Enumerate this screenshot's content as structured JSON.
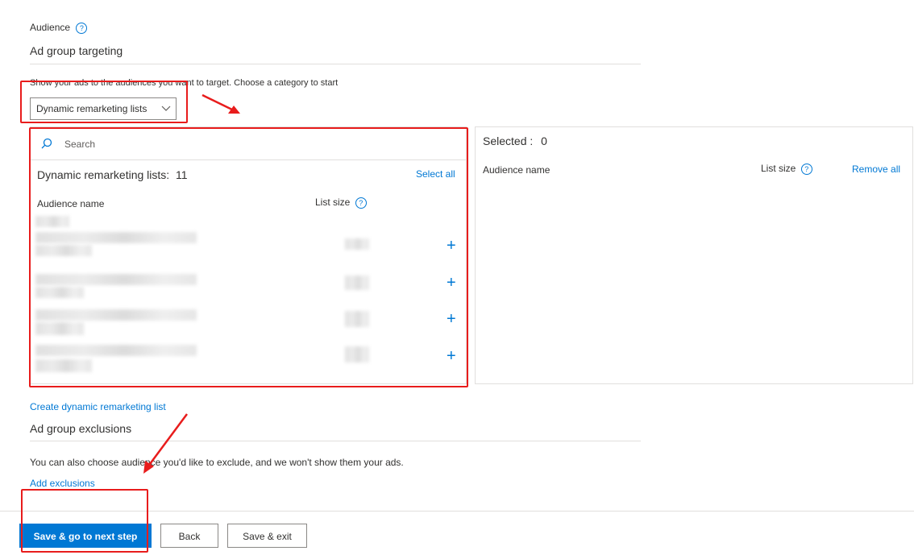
{
  "audience": {
    "label": "Audience",
    "help": "?"
  },
  "targeting": {
    "title": "Ad group targeting",
    "instruction": "Show your ads to the audiences you want to target. Choose a category to start",
    "category_value": "Dynamic remarketing lists"
  },
  "left_panel": {
    "search_placeholder": "Search",
    "count_label": "Dynamic remarketing lists:",
    "count": "11",
    "select_all": "Select all",
    "col_name": "Audience name",
    "col_size": "List size",
    "help": "?"
  },
  "right_panel": {
    "selected_label": "Selected :",
    "selected_count": "0",
    "col_name": "Audience name",
    "col_size": "List size",
    "help": "?",
    "remove_all": "Remove all"
  },
  "create_link": "Create dynamic remarketing list",
  "exclusions": {
    "title": "Ad group exclusions",
    "text": "You can also choose audience you'd like to exclude, and we won't show them your ads.",
    "add_link": "Add exclusions"
  },
  "footer": {
    "save_next": "Save & go to next step",
    "back": "Back",
    "save_exit": "Save & exit"
  },
  "colors": {
    "accent": "#0078d4",
    "annotation": "#e81c1c"
  }
}
